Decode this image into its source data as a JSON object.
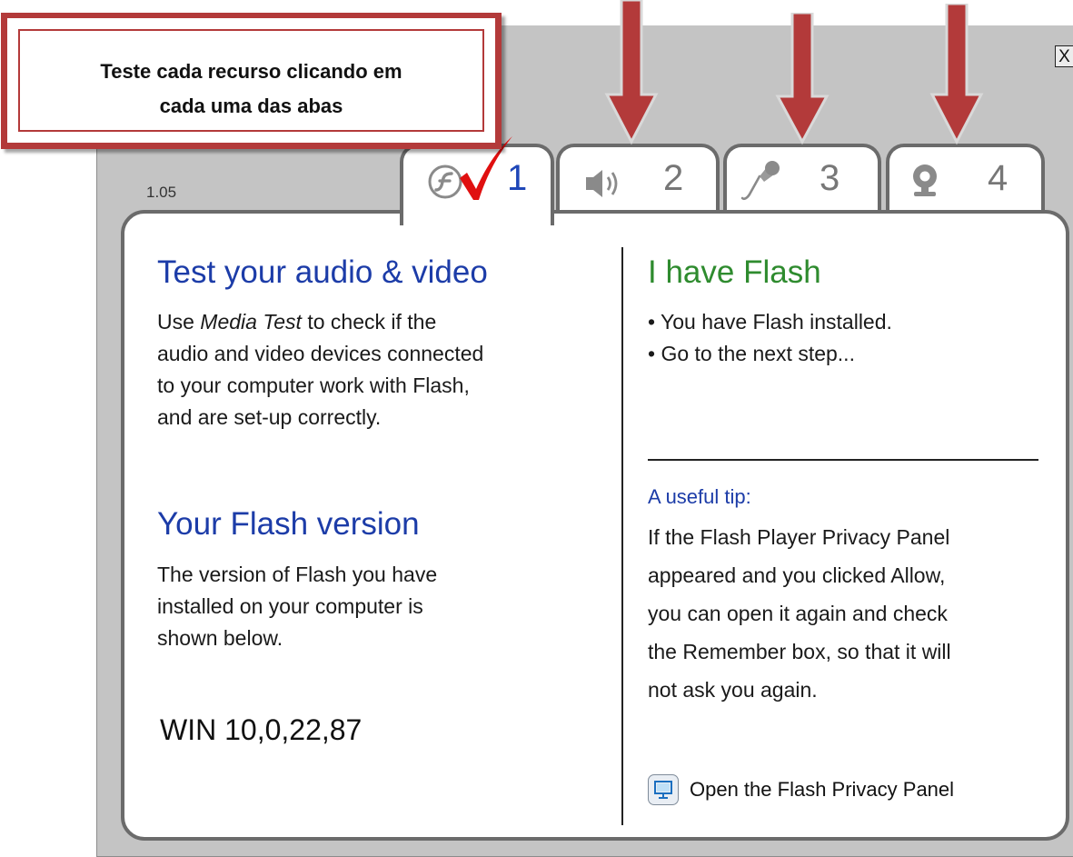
{
  "window": {
    "version_small": "1.05",
    "close_label": "X"
  },
  "annotation": {
    "text": "Teste cada recurso clicando em\ncada uma das abas",
    "color": "#b33a3a"
  },
  "tabs": [
    {
      "number": "1",
      "icon": "flash-icon",
      "active": true,
      "checkmark": true
    },
    {
      "number": "2",
      "icon": "speaker-icon",
      "active": false
    },
    {
      "number": "3",
      "icon": "microphone-icon",
      "active": false
    },
    {
      "number": "4",
      "icon": "webcam-icon",
      "active": false
    }
  ],
  "left": {
    "heading1": "Test your audio & video",
    "intro_prefix": "Use ",
    "intro_em": "Media Test",
    "intro_line1_rest": " to check if the",
    "intro_lines": [
      "audio and video devices connected",
      "to your computer work with Flash,",
      "and are set-up correctly."
    ],
    "heading2": "Your Flash version",
    "version_lines": [
      "The version of Flash you have",
      "installed on your computer is",
      "shown below."
    ],
    "version_value": "WIN 10,0,22,87"
  },
  "right": {
    "heading": "I have Flash",
    "bullets": [
      "• You have Flash installed.",
      "• Go to the next step..."
    ],
    "tip_title": "A useful tip:",
    "tip_lines": [
      "If the Flash Player Privacy Panel",
      "appeared and you clicked Allow,",
      "you can open it again and check",
      "the Remember box, so that it will",
      "not ask you again."
    ],
    "privacy_button_label": "Open the Flash Privacy Panel"
  },
  "colors": {
    "heading_blue": "#1c3ca8",
    "heading_green": "#2e8b2e",
    "check_red": "#e01010",
    "arrow_red": "#b33a3a"
  }
}
